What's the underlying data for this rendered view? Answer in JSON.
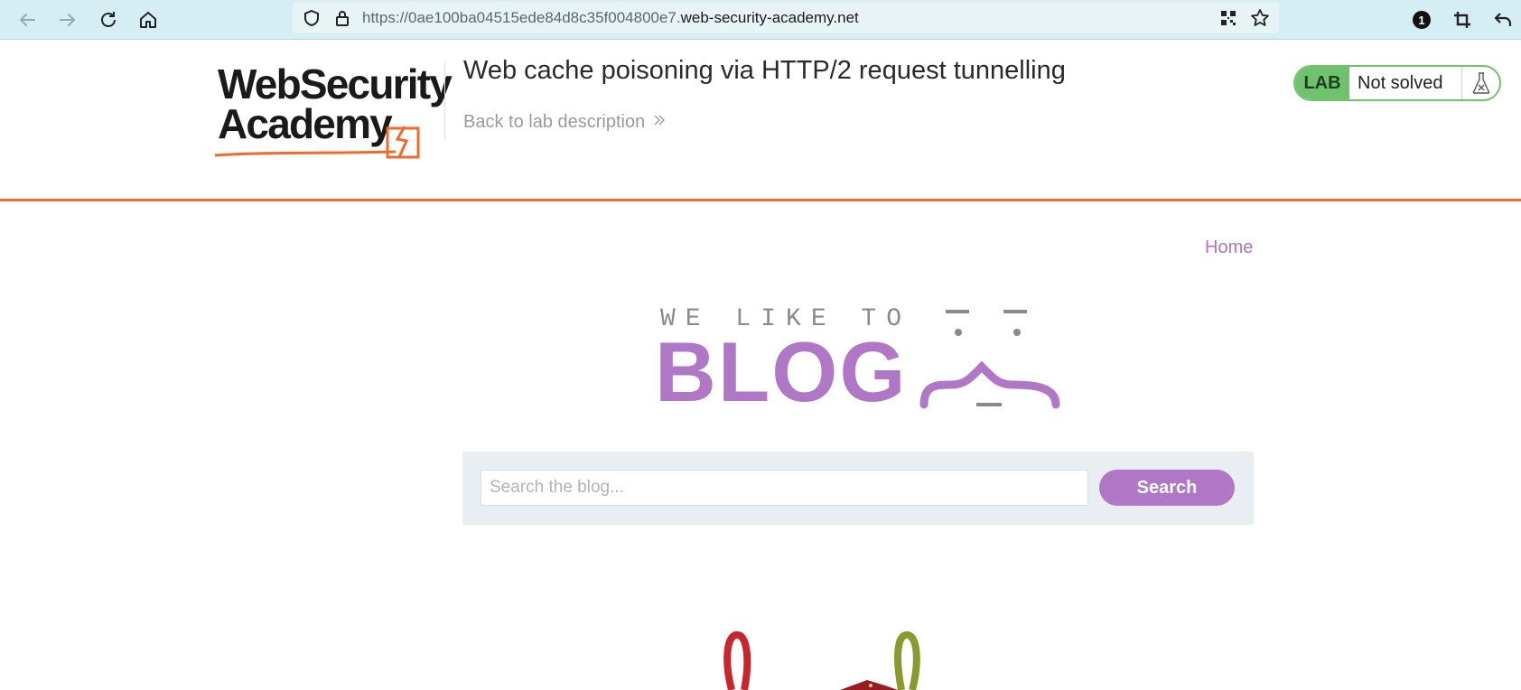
{
  "browser": {
    "url_prefix": "https://0ae100ba04515ede84d8c35f004800e7.",
    "url_domain": "web-security-academy.net",
    "notification_count": "1"
  },
  "lab": {
    "logo_line1": "WebSecurity",
    "logo_line2": "Academy",
    "title": "Web cache poisoning via HTTP/2 request tunnelling",
    "back_link": "Back to lab description",
    "status_badge": "LAB",
    "status_text": "Not solved"
  },
  "site": {
    "nav_home": "Home",
    "logo_top": "WE LIKE TO",
    "logo_main": "BLOG",
    "search_placeholder": "Search the blog...",
    "search_button": "Search"
  },
  "colors": {
    "accent_orange": "#ee6a2d",
    "blog_purple": "#b077c6",
    "solved_green": "#6fc36f",
    "toolbar_bg": "#d4eef3"
  }
}
